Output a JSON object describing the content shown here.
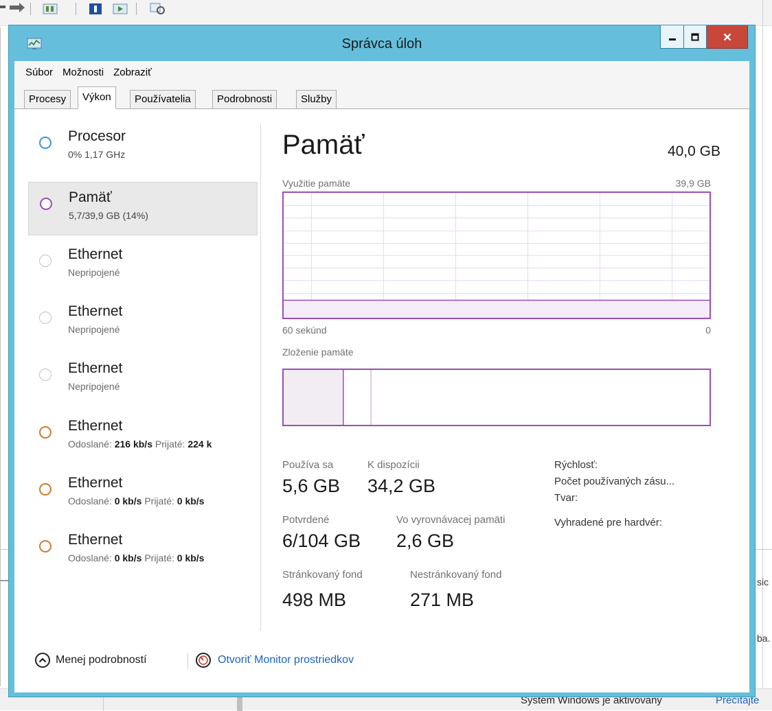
{
  "window": {
    "title": "Správca úloh"
  },
  "menu": {
    "items": [
      "Súbor",
      "Možnosti",
      "Zobraziť"
    ]
  },
  "tabs": [
    {
      "label": "Procesy",
      "active": false
    },
    {
      "label": "Výkon",
      "active": true
    },
    {
      "label": "Používatelia",
      "active": false
    },
    {
      "label": "Podrobnosti",
      "active": false
    },
    {
      "label": "Služby",
      "active": false
    }
  ],
  "resources": [
    {
      "name": "Procesor",
      "sub": "0% 1,17 GHz",
      "color": "#3c96d2",
      "selected": false
    },
    {
      "name": "Pamäť",
      "sub": "5,7/39,9 GB (14%)",
      "color": "#9b4db5",
      "selected": true
    },
    {
      "name": "Ethernet",
      "sub": "Nepripojené",
      "color": "#b5b5b5",
      "selected": false
    },
    {
      "name": "Ethernet",
      "sub": "Nepripojené",
      "color": "#b5b5b5",
      "selected": false
    },
    {
      "name": "Ethernet",
      "sub": "Nepripojené",
      "color": "#b5b5b5",
      "selected": false
    },
    {
      "name": "Ethernet",
      "sent_label": "Odoslané:",
      "sent": "216 kb/s",
      "recv_label": "Prijaté:",
      "recv": "224 k",
      "color": "#d07a2c",
      "selected": false
    },
    {
      "name": "Ethernet",
      "sent_label": "Odoslané:",
      "sent": "0 kb/s",
      "recv_label": "Prijaté:",
      "recv": "0 kb/s",
      "color": "#d07a2c",
      "selected": false
    },
    {
      "name": "Ethernet",
      "sent_label": "Odoslané:",
      "sent": "0 kb/s",
      "recv_label": "Prijaté:",
      "recv": "0 kb/s",
      "color": "#d07a2c",
      "selected": false
    }
  ],
  "detail": {
    "title": "Pamäť",
    "total": "40,0 GB",
    "usage_label": "Využitie pamäte",
    "usage_max": "39,9 GB",
    "time_label": "60 sekúnd",
    "time_end": "0",
    "composition_label": "Zloženie pamäte",
    "usage_fraction": 0.14,
    "composition": {
      "in_use": 0.14,
      "modified": 0.065
    },
    "accent_color": "#9b4db5",
    "stats": {
      "in_use_label": "Používa sa",
      "in_use_value": "5,6 GB",
      "available_label": "K dispozícii",
      "available_value": "34,2 GB",
      "committed_label": "Potvrdené",
      "committed_value": "6/104 GB",
      "cached_label": "Vo vyrovnávacej pamäti",
      "cached_value": "2,6 GB",
      "paged_label": "Stránkovaný fond",
      "paged_value": "498 MB",
      "nonpaged_label": "Nestránkovaný fond",
      "nonpaged_value": "271 MB"
    },
    "properties": {
      "speed": "Rýchlosť:",
      "slots": "Počet používaných zásu...",
      "form": "Tvar:",
      "reserved": "Vyhradené pre hardvér:"
    }
  },
  "bottom": {
    "fewer_details": "Menej podrobností",
    "open_monitor": "Otvoriť Monitor prostriedkov"
  },
  "background": {
    "side_text_1": "sic",
    "side_text_2": "ba.",
    "status_text": "Systém Windows je aktivovaný",
    "status_link": "Prečítajte"
  }
}
